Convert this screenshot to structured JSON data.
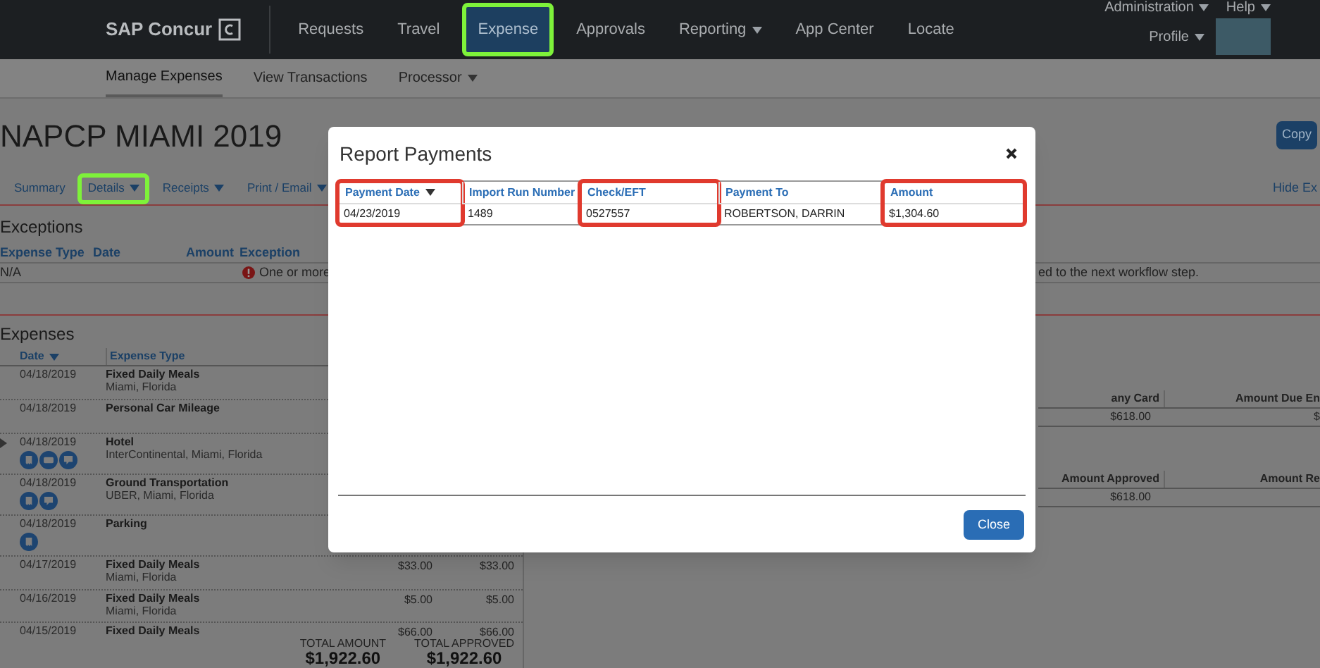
{
  "top_nav": {
    "logo": "SAP Concur",
    "items": [
      {
        "label": "Requests",
        "dropdown": false,
        "selected": false,
        "highlighted": false
      },
      {
        "label": "Travel",
        "dropdown": false,
        "selected": false,
        "highlighted": false
      },
      {
        "label": "Expense",
        "dropdown": false,
        "selected": true,
        "highlighted": true
      },
      {
        "label": "Approvals",
        "dropdown": false,
        "selected": false,
        "highlighted": false
      },
      {
        "label": "Reporting",
        "dropdown": true,
        "selected": false,
        "highlighted": false
      },
      {
        "label": "App Center",
        "dropdown": false,
        "selected": false,
        "highlighted": false
      },
      {
        "label": "Locate",
        "dropdown": false,
        "selected": false,
        "highlighted": false
      }
    ],
    "utility_menu": [
      {
        "label": "Administration",
        "dropdown": true
      },
      {
        "label": "Help",
        "dropdown": true
      }
    ],
    "profile": {
      "label": "Profile",
      "dropdown": true
    }
  },
  "sub_nav": {
    "items": [
      {
        "label": "Manage Expenses",
        "dropdown": false,
        "selected": true
      },
      {
        "label": "View Transactions",
        "dropdown": false,
        "selected": false
      },
      {
        "label": "Processor",
        "dropdown": true,
        "selected": false
      }
    ]
  },
  "report": {
    "title": "NAPCP MIAMI 2019",
    "copy_button": "Copy",
    "hide_link": "Hide Ex",
    "tabs": [
      {
        "label": "Summary",
        "dropdown": false,
        "highlighted": false
      },
      {
        "label": "Details",
        "dropdown": true,
        "highlighted": true
      },
      {
        "label": "Receipts",
        "dropdown": true,
        "highlighted": false
      },
      {
        "label": "Print / Email",
        "dropdown": true,
        "highlighted": false
      }
    ]
  },
  "exceptions": {
    "title": "Exceptions",
    "columns": [
      "Expense Type",
      "Date",
      "Amount",
      "Exception"
    ],
    "rows": [
      {
        "expense_type": "N/A",
        "exception_start": "One or more",
        "exception_end": "ed to the next workflow step."
      }
    ]
  },
  "expenses": {
    "title": "Expenses",
    "columns": [
      {
        "label": "Date",
        "sorted": true
      },
      {
        "label": "Expense Type",
        "sorted": false
      }
    ],
    "rows": [
      {
        "date": "04/18/2019",
        "type": "Fixed Daily Meals",
        "detail": "Miami, Florida",
        "icons": [],
        "expandable": false
      },
      {
        "date": "04/18/2019",
        "type": "Personal Car Mileage",
        "icons": [],
        "expandable": false
      },
      {
        "date": "04/18/2019",
        "type": "Hotel",
        "detail": "InterContinental, Miami, Florida",
        "icons": [
          {
            "kind": "receipt"
          },
          {
            "kind": "card"
          },
          {
            "kind": "comment"
          }
        ],
        "expandable": true
      },
      {
        "date": "04/18/2019",
        "type": "Ground Transportation",
        "detail": "UBER, Miami, Florida",
        "icons": [
          {
            "kind": "receipt"
          },
          {
            "kind": "comment"
          }
        ],
        "expandable": false
      },
      {
        "date": "04/18/2019",
        "type": "Parking",
        "icons": [
          {
            "kind": "receipt"
          }
        ],
        "expandable": false
      },
      {
        "date": "04/17/2019",
        "type": "Fixed Daily Meals",
        "detail": "Miami, Florida",
        "amount": "$33.00",
        "approved": "$33.00",
        "icons": [],
        "expandable": false
      },
      {
        "date": "04/16/2019",
        "type": "Fixed Daily Meals",
        "detail": "Miami, Florida",
        "amount": "$5.00",
        "approved": "$5.00",
        "icons": [],
        "expandable": false
      },
      {
        "date": "04/15/2019",
        "type": "Fixed Daily Meals",
        "amount": "$66.00",
        "approved": "$66.00",
        "icons": [],
        "expandable": false
      }
    ],
    "totals": [
      {
        "label": "TOTAL AMOUNT",
        "value": "$1,922.60"
      },
      {
        "label": "TOTAL APPROVED",
        "value": "$1,922.60"
      }
    ]
  },
  "summary_tables": [
    {
      "columns": [
        "any Card",
        "Amount Due En"
      ],
      "row": [
        "$618.00",
        "$"
      ]
    },
    {
      "columns": [
        "Amount Approved",
        "Amount Re"
      ],
      "row": [
        "$618.00"
      ]
    }
  ],
  "modal": {
    "title": "Report Payments",
    "columns": [
      {
        "label": "Payment Date",
        "sorted": true,
        "highlighted": true,
        "value": "04/23/2019"
      },
      {
        "label": "Import Run Number",
        "sorted": false,
        "highlighted": false,
        "value": "1489"
      },
      {
        "label": "Check/EFT",
        "sorted": false,
        "highlighted": true,
        "value": "0527557"
      },
      {
        "label": "Payment To",
        "sorted": false,
        "highlighted": false,
        "value": "ROBERTSON, DARRIN"
      },
      {
        "label": "Amount",
        "sorted": false,
        "highlighted": true,
        "value": "$1,304.60"
      }
    ],
    "close_button": "Close"
  }
}
